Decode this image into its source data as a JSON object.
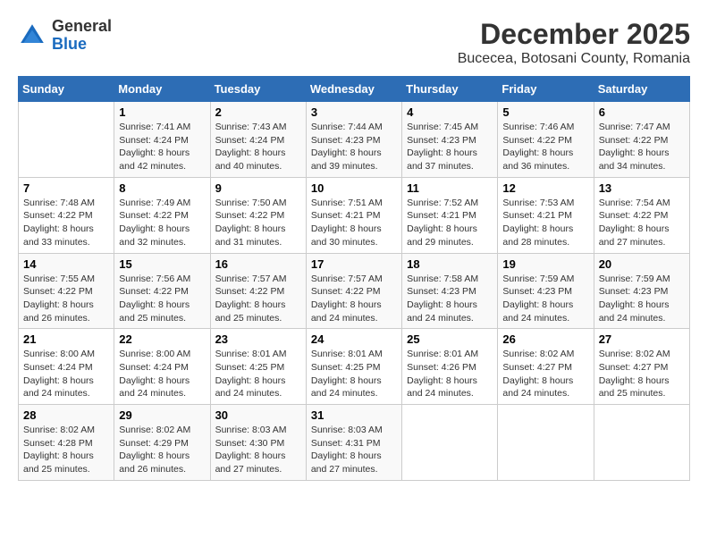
{
  "logo": {
    "line1": "General",
    "line2": "Blue"
  },
  "title": "December 2025",
  "subtitle": "Bucecea, Botosani County, Romania",
  "weekdays": [
    "Sunday",
    "Monday",
    "Tuesday",
    "Wednesday",
    "Thursday",
    "Friday",
    "Saturday"
  ],
  "weeks": [
    [
      {
        "day": "",
        "info": ""
      },
      {
        "day": "1",
        "info": "Sunrise: 7:41 AM\nSunset: 4:24 PM\nDaylight: 8 hours\nand 42 minutes."
      },
      {
        "day": "2",
        "info": "Sunrise: 7:43 AM\nSunset: 4:24 PM\nDaylight: 8 hours\nand 40 minutes."
      },
      {
        "day": "3",
        "info": "Sunrise: 7:44 AM\nSunset: 4:23 PM\nDaylight: 8 hours\nand 39 minutes."
      },
      {
        "day": "4",
        "info": "Sunrise: 7:45 AM\nSunset: 4:23 PM\nDaylight: 8 hours\nand 37 minutes."
      },
      {
        "day": "5",
        "info": "Sunrise: 7:46 AM\nSunset: 4:22 PM\nDaylight: 8 hours\nand 36 minutes."
      },
      {
        "day": "6",
        "info": "Sunrise: 7:47 AM\nSunset: 4:22 PM\nDaylight: 8 hours\nand 34 minutes."
      }
    ],
    [
      {
        "day": "7",
        "info": "Sunrise: 7:48 AM\nSunset: 4:22 PM\nDaylight: 8 hours\nand 33 minutes."
      },
      {
        "day": "8",
        "info": "Sunrise: 7:49 AM\nSunset: 4:22 PM\nDaylight: 8 hours\nand 32 minutes."
      },
      {
        "day": "9",
        "info": "Sunrise: 7:50 AM\nSunset: 4:22 PM\nDaylight: 8 hours\nand 31 minutes."
      },
      {
        "day": "10",
        "info": "Sunrise: 7:51 AM\nSunset: 4:21 PM\nDaylight: 8 hours\nand 30 minutes."
      },
      {
        "day": "11",
        "info": "Sunrise: 7:52 AM\nSunset: 4:21 PM\nDaylight: 8 hours\nand 29 minutes."
      },
      {
        "day": "12",
        "info": "Sunrise: 7:53 AM\nSunset: 4:21 PM\nDaylight: 8 hours\nand 28 minutes."
      },
      {
        "day": "13",
        "info": "Sunrise: 7:54 AM\nSunset: 4:22 PM\nDaylight: 8 hours\nand 27 minutes."
      }
    ],
    [
      {
        "day": "14",
        "info": "Sunrise: 7:55 AM\nSunset: 4:22 PM\nDaylight: 8 hours\nand 26 minutes."
      },
      {
        "day": "15",
        "info": "Sunrise: 7:56 AM\nSunset: 4:22 PM\nDaylight: 8 hours\nand 25 minutes."
      },
      {
        "day": "16",
        "info": "Sunrise: 7:57 AM\nSunset: 4:22 PM\nDaylight: 8 hours\nand 25 minutes."
      },
      {
        "day": "17",
        "info": "Sunrise: 7:57 AM\nSunset: 4:22 PM\nDaylight: 8 hours\nand 24 minutes."
      },
      {
        "day": "18",
        "info": "Sunrise: 7:58 AM\nSunset: 4:23 PM\nDaylight: 8 hours\nand 24 minutes."
      },
      {
        "day": "19",
        "info": "Sunrise: 7:59 AM\nSunset: 4:23 PM\nDaylight: 8 hours\nand 24 minutes."
      },
      {
        "day": "20",
        "info": "Sunrise: 7:59 AM\nSunset: 4:23 PM\nDaylight: 8 hours\nand 24 minutes."
      }
    ],
    [
      {
        "day": "21",
        "info": "Sunrise: 8:00 AM\nSunset: 4:24 PM\nDaylight: 8 hours\nand 24 minutes."
      },
      {
        "day": "22",
        "info": "Sunrise: 8:00 AM\nSunset: 4:24 PM\nDaylight: 8 hours\nand 24 minutes."
      },
      {
        "day": "23",
        "info": "Sunrise: 8:01 AM\nSunset: 4:25 PM\nDaylight: 8 hours\nand 24 minutes."
      },
      {
        "day": "24",
        "info": "Sunrise: 8:01 AM\nSunset: 4:25 PM\nDaylight: 8 hours\nand 24 minutes."
      },
      {
        "day": "25",
        "info": "Sunrise: 8:01 AM\nSunset: 4:26 PM\nDaylight: 8 hours\nand 24 minutes."
      },
      {
        "day": "26",
        "info": "Sunrise: 8:02 AM\nSunset: 4:27 PM\nDaylight: 8 hours\nand 24 minutes."
      },
      {
        "day": "27",
        "info": "Sunrise: 8:02 AM\nSunset: 4:27 PM\nDaylight: 8 hours\nand 25 minutes."
      }
    ],
    [
      {
        "day": "28",
        "info": "Sunrise: 8:02 AM\nSunset: 4:28 PM\nDaylight: 8 hours\nand 25 minutes."
      },
      {
        "day": "29",
        "info": "Sunrise: 8:02 AM\nSunset: 4:29 PM\nDaylight: 8 hours\nand 26 minutes."
      },
      {
        "day": "30",
        "info": "Sunrise: 8:03 AM\nSunset: 4:30 PM\nDaylight: 8 hours\nand 27 minutes."
      },
      {
        "day": "31",
        "info": "Sunrise: 8:03 AM\nSunset: 4:31 PM\nDaylight: 8 hours\nand 27 minutes."
      },
      {
        "day": "",
        "info": ""
      },
      {
        "day": "",
        "info": ""
      },
      {
        "day": "",
        "info": ""
      }
    ]
  ]
}
